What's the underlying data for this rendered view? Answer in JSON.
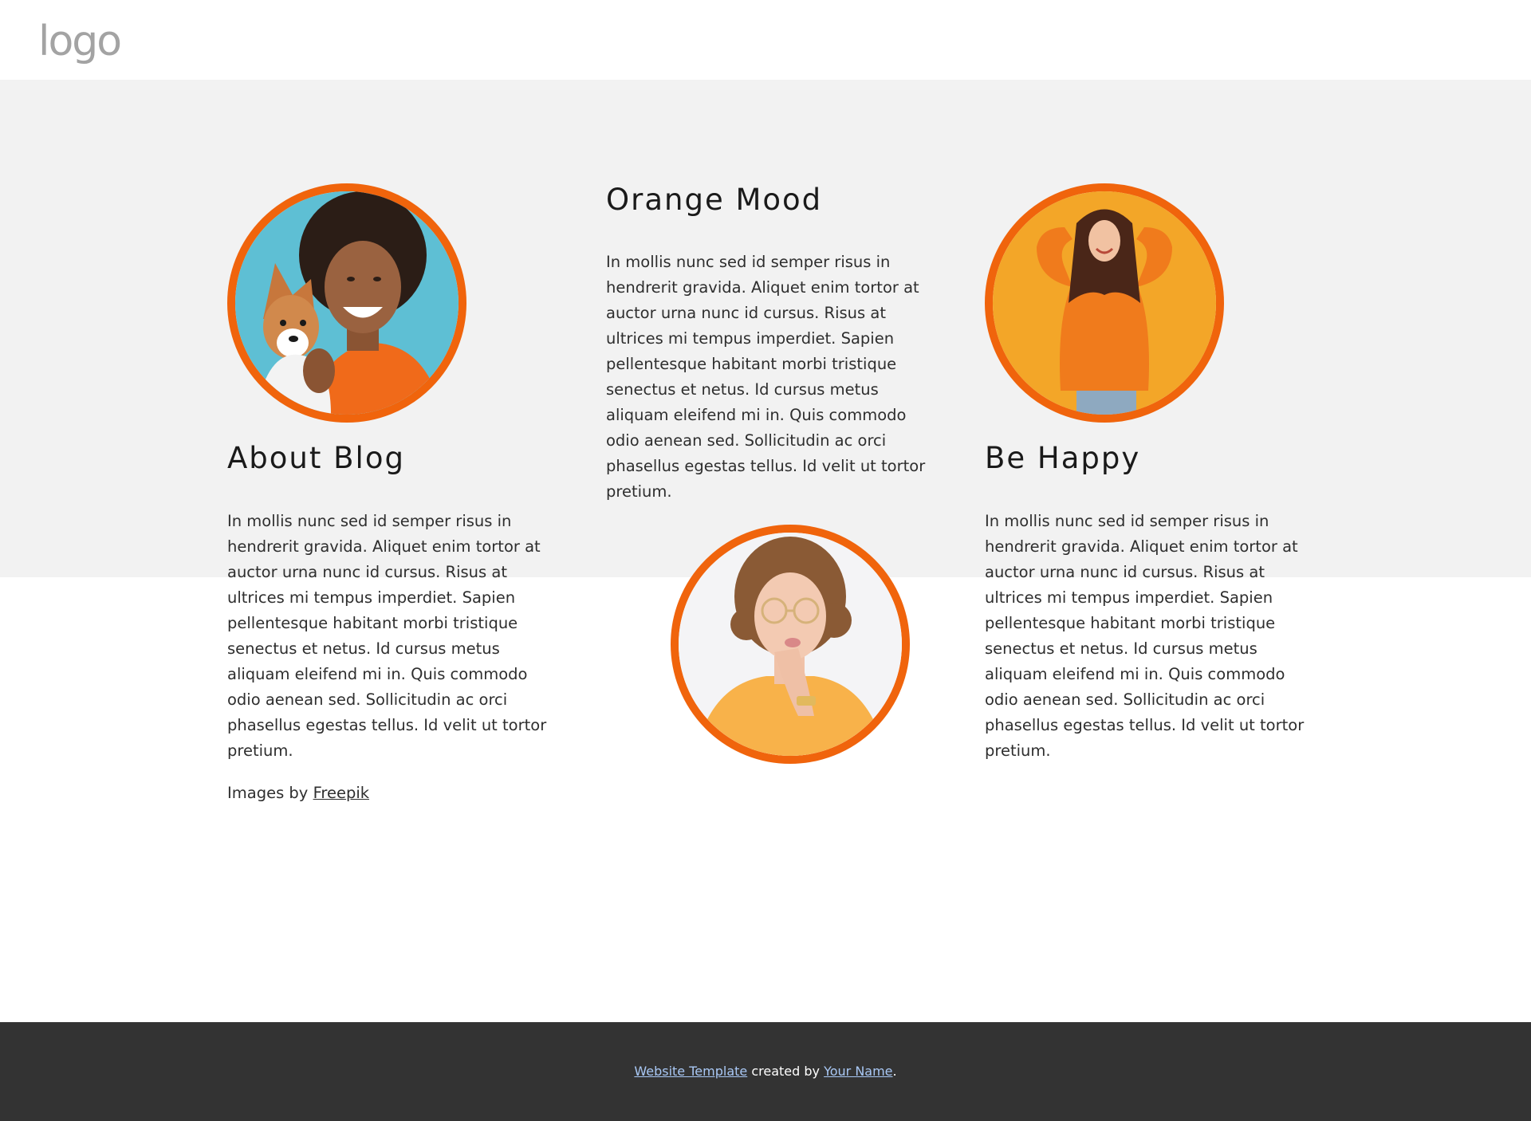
{
  "header": {
    "logo_text": "logo"
  },
  "sections": [
    {
      "heading": "About Blog",
      "text": "In mollis nunc sed id semper risus in hendrerit gravida. Aliquet enim tortor at auctor urna nunc id cursus. Risus at ultrices mi tempus imperdiet. Sapien pellentesque habitant morbi tristique senectus et netus. Id cursus metus aliquam eleifend mi in. Quis commodo odio aenean sed. Sollicitudin ac orci phasellus egestas tellus. Id velit ut tortor pretium."
    },
    {
      "heading": "Orange Mood",
      "text": "In mollis nunc sed id semper risus in hendrerit gravida. Aliquet enim tortor at auctor urna nunc id cursus. Risus at ultrices mi tempus imperdiet. Sapien pellentesque habitant morbi tristique senectus et netus. Id cursus metus aliquam eleifend mi in. Quis commodo odio aenean sed. Sollicitudin ac orci phasellus egestas tellus. Id velit ut tortor pretium."
    },
    {
      "heading": "Be Happy",
      "text": "In mollis nunc sed id semper risus in hendrerit gravida. Aliquet enim tortor at auctor urna nunc id cursus. Risus at ultrices mi tempus imperdiet. Sapien pellentesque habitant morbi tristique senectus et netus. Id cursus metus aliquam eleifend mi in. Quis commodo odio aenean sed. Sollicitudin ac orci phasellus egestas tellus. Id velit ut tortor pretium."
    }
  ],
  "credit": {
    "prefix": "Images by",
    "link_label": "Freepik"
  },
  "footer": {
    "template_link": "Website Template",
    "middle_text": "created by",
    "author_link": "Your Name",
    "suffix": "."
  },
  "colors": {
    "accent": "#f0640c",
    "band": "#f2f2f2",
    "footer_bg": "#333333",
    "footer_link": "#a9c8f5"
  }
}
